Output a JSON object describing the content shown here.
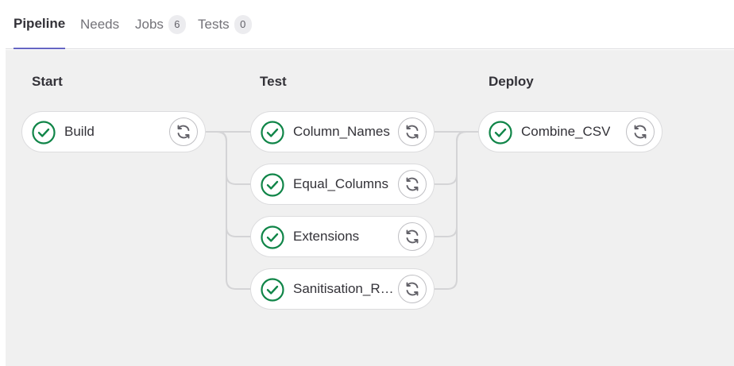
{
  "tabs": [
    {
      "label": "Pipeline",
      "active": true
    },
    {
      "label": "Needs"
    },
    {
      "label": "Jobs",
      "count": "6"
    },
    {
      "label": "Tests",
      "count": "0"
    }
  ],
  "stages": [
    {
      "title": "Start",
      "jobs": [
        {
          "name": "Build",
          "status": "success"
        }
      ]
    },
    {
      "title": "Test",
      "jobs": [
        {
          "name": "Column_Names",
          "status": "success"
        },
        {
          "name": "Equal_Columns",
          "status": "success"
        },
        {
          "name": "Extensions",
          "status": "success"
        },
        {
          "name": "Sanitisation_Re...",
          "status": "success"
        }
      ]
    },
    {
      "title": "Deploy",
      "jobs": [
        {
          "name": "Combine_CSV",
          "status": "success"
        }
      ]
    }
  ],
  "icons": {
    "status": "check-circle-icon",
    "action": "retry-icon"
  },
  "colors": {
    "success": "#108548",
    "active_tab_underline": "#6666c4",
    "graph_bg": "#f0f0f0"
  }
}
